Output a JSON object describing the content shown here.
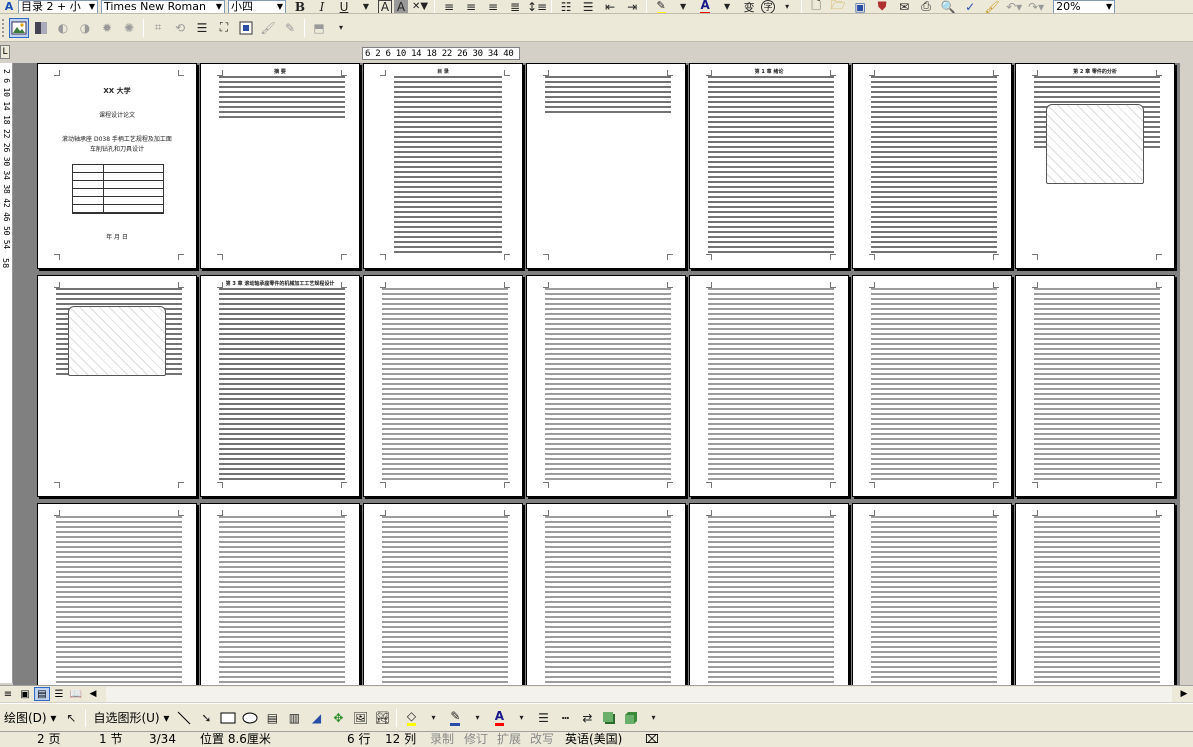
{
  "format_toolbar": {
    "style": "目录 2 + 小",
    "font": "Times New Roman",
    "size": "小四",
    "bold": "B",
    "italic": "I",
    "underline": "U",
    "char_border": "A",
    "char_shade": "A",
    "font_color_letter": "A",
    "phonetic": "变",
    "enclose": "字",
    "zoom": "20%"
  },
  "ruler": {
    "corner": "L",
    "ticks": "6  2  6  10  14  18  22 26  30  34  40"
  },
  "vruler": {
    "ticks": "2  6  10 14 18 22 26 30 34 38 42 46 50 54",
    "mark": "58"
  },
  "pages": [
    {
      "title": "XX 大学",
      "subtitle": "课程设计论文",
      "line1": "滚动轴承座 D038 手柄工艺规程及加工面",
      "line2": "车削钻孔和刀具设计",
      "footer": "年   月   日"
    },
    {
      "title": "摘 要"
    },
    {
      "title": "目 录"
    },
    {
      "title": ""
    },
    {
      "title": "第 1 章 绪论"
    },
    {
      "title": ""
    },
    {
      "title": "第 2 章 零件的分析"
    },
    {
      "title": ""
    },
    {
      "title": "第 3 章 滚动轴承座零件的机械加工工艺规程设计"
    },
    {
      "title": ""
    },
    {
      "title": ""
    },
    {
      "title": ""
    },
    {
      "title": ""
    },
    {
      "title": ""
    },
    {
      "title": ""
    },
    {
      "title": ""
    },
    {
      "title": ""
    },
    {
      "title": ""
    },
    {
      "title": ""
    },
    {
      "title": ""
    },
    {
      "title": ""
    }
  ],
  "draw_toolbar": {
    "draw_label": "绘图(D)",
    "autoshapes_label": "自选图形(U)"
  },
  "status": {
    "page": "2 页",
    "section": "1 节",
    "page_of": "3/34",
    "position": "位置 8.6厘米",
    "line": "6 行",
    "column": "12 列",
    "rec": "录制",
    "trk": "修订",
    "ext": "扩展",
    "ovr": "改写",
    "language": "英语(美国)"
  },
  "colors": {
    "highlight": "#ffff00",
    "font_color": "#ff0000",
    "chrome": "#ece9d8",
    "doc_bg": "#808080"
  }
}
